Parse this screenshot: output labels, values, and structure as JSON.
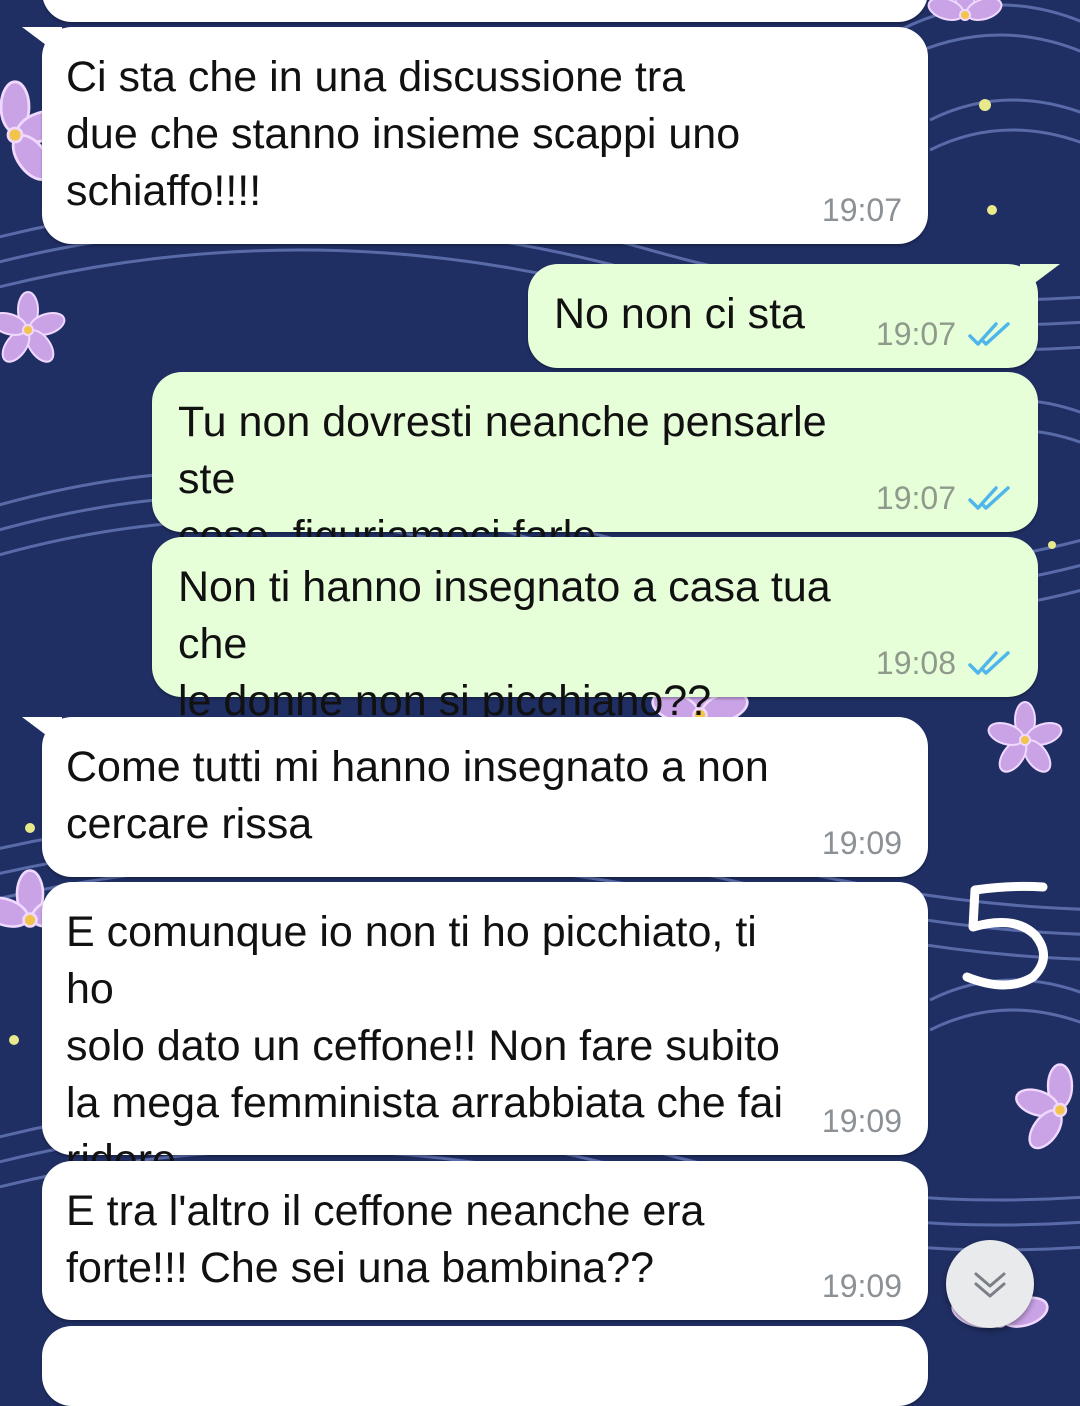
{
  "messages": [
    {
      "direction": "in",
      "text": "",
      "time": ""
    },
    {
      "direction": "in",
      "text": "Ci sta che in una discussione tra\ndue che stanno insieme scappi uno\nschiaffo!!!!",
      "time": "19:07"
    },
    {
      "direction": "out",
      "text": "No non ci sta",
      "time": "19:07",
      "status": "read"
    },
    {
      "direction": "out",
      "text": "Tu non dovresti neanche pensarle ste\ncose, figuriamoci farle",
      "time": "19:07",
      "status": "read"
    },
    {
      "direction": "out",
      "text": "Non ti hanno insegnato a casa tua che\nle donne non si picchiano??",
      "time": "19:08",
      "status": "read"
    },
    {
      "direction": "in",
      "text": "Come tutti mi hanno insegnato a non\ncercare rissa",
      "time": "19:09"
    },
    {
      "direction": "in",
      "text": "E comunque io non ti ho picchiato, ti ho\nsolo dato un ceffone!! Non fare subito\nla mega femminista arrabbiata che fai\nridere",
      "time": "19:09"
    },
    {
      "direction": "in",
      "text": "E tra l'altro il ceffone neanche era\nforte!!! Che sei una bambina??",
      "time": "19:09"
    },
    {
      "direction": "in",
      "text": "",
      "time": ""
    }
  ],
  "annotation": {
    "label": "5"
  },
  "scroll_button": {
    "icon": "double-chevron-down-icon"
  },
  "colors": {
    "wallpaper": "#1f2e63",
    "incoming_bubble": "#ffffff",
    "outgoing_bubble": "#e6ffd9",
    "read_ticks": "#4fb6ec",
    "timestamp": "#8c9196"
  }
}
